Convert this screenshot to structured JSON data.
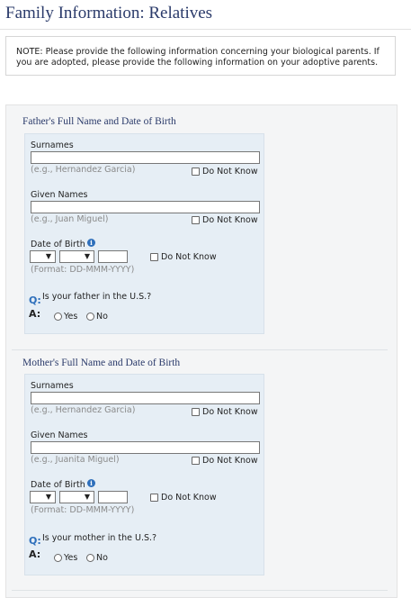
{
  "page": {
    "title": "Family Information: Relatives",
    "note": "NOTE: Please provide the following information concerning your biological parents. If you are adopted, please provide the following information on your adoptive parents."
  },
  "father": {
    "section_title": "Father's Full Name and Date of Birth",
    "surnames_label": "Surnames",
    "surnames_value": "",
    "surnames_hint": "(e.g., Hernandez Garcia)",
    "given_label": "Given Names",
    "given_value": "",
    "given_hint": "(e.g., Juan Miguel)",
    "do_not_know": "Do Not Know",
    "dob_label": "Date of Birth",
    "dob_day": "",
    "dob_month": "",
    "dob_year": "",
    "dob_hint": "(Format: DD-MMM-YYYY)",
    "q_label": "Q:",
    "question": "Is your father in the U.S.?",
    "a_label": "A:",
    "yes": "Yes",
    "no": "No"
  },
  "mother": {
    "section_title": "Mother's Full Name and Date of Birth",
    "surnames_label": "Surnames",
    "surnames_value": "",
    "surnames_hint": "(e.g., Hernandez Garcia)",
    "given_label": "Given Names",
    "given_value": "",
    "given_hint": "(e.g., Juanita Miguel)",
    "do_not_know": "Do Not Know",
    "dob_label": "Date of Birth",
    "dob_day": "",
    "dob_month": "",
    "dob_year": "",
    "dob_hint": "(Format: DD-MMM-YYYY)",
    "q_label": "Q:",
    "question": "Is your mother in the U.S.?",
    "a_label": "A:",
    "yes": "Yes",
    "no": "No"
  },
  "icons": {
    "info": "info-icon",
    "chevron": "chevron-down-icon"
  },
  "colors": {
    "title": "#2a3a6a",
    "panel_bg": "#e6eef5",
    "outer_bg": "#f4f5f6",
    "q_accent": "#2e6fbb",
    "hint": "#8a8a8a"
  }
}
